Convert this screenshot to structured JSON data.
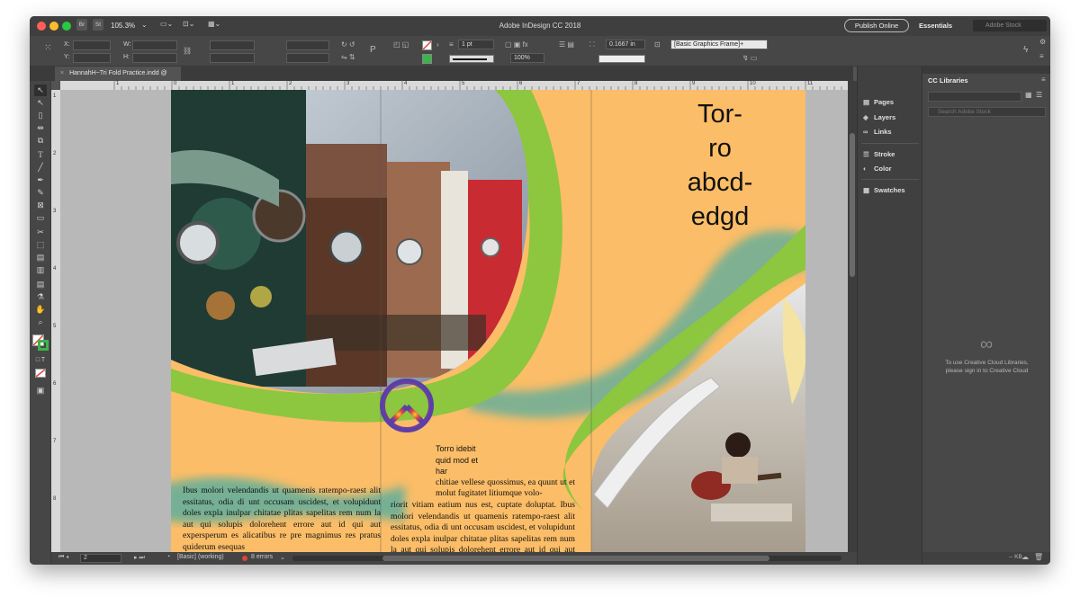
{
  "window": {
    "title": "Adobe InDesign CC 2018",
    "traffic_lights": [
      "#ff5f57",
      "#febc2e",
      "#28c840"
    ]
  },
  "titlebar": {
    "br_label": "Br",
    "st_label": "St",
    "zoom": "105.3%",
    "publish_label": "Publish Online",
    "workspace": "Essentials",
    "stock_placeholder": "Adobe Stock"
  },
  "control": {
    "x_label": "X:",
    "y_label": "Y:",
    "w_label": "W:",
    "h_label": "H:",
    "stroke_weight": "1 pt",
    "stroke_offset": "0.1667 in",
    "opacity": "100%",
    "object_style": "[Basic Graphics Frame]+"
  },
  "tab": {
    "close_glyph": "×",
    "label": "HannahH~Tri Fold Practice.indd @ 105%"
  },
  "ruler": {
    "h_ticks": [
      "1",
      "0",
      "1",
      "2",
      "3",
      "4",
      "5",
      "6",
      "7",
      "8",
      "9",
      "10",
      "11"
    ],
    "v_ticks": [
      "1",
      "2",
      "3",
      "4",
      "5",
      "6",
      "7",
      "8"
    ]
  },
  "document": {
    "page_color": "#fbbd67",
    "green_color": "#8dc63f",
    "teal_color": "#5fae9c",
    "headline": [
      "Tor-",
      "ro",
      "abcd-",
      "edgd"
    ],
    "col1_text": "Ibus molori velendandis ut quamenis ratempo-raest alit essitatus, odia di unt occusam uscidest, et volupidunt doles expla inulpar chitatae plitas sapelitas rem num la aut qui solupis dolorehent errore aut id qui aut expersperum es alicatibus re pre magnimus res pratus quiderum esequas",
    "col2_head": "Torro idebit quid mod et har",
    "col2_indent": "chitiae vellese quossimus, ea quunt ut et molut fugitatet litiumque volo-",
    "col2_text": "riorit vitiam eatium nus est, cuptate doluptat. Ibus molori velendandis ut quamenis ratempo-raest alit essitatus, odia di unt occusam uscidest, et volupidunt doles expla inulpar chitatae plitas sapelitas rem num la aut qui solupis dolorehent errore aut id qui aut expersperum es alicatibus re pre magnimus res pratus quiderum esequas comnimus ipiet debis mod et la dolupit et, elis sint vellupt aepelit quunt perit int, si ne consed essim comnihic to moluptae porporios rehenda"
  },
  "status": {
    "page_number": "2",
    "preflight_profile": "[Basic] (working)",
    "errors": "8 errors",
    "error_color": "#e0453a"
  },
  "panels": {
    "items": [
      {
        "icon": "pages-icon",
        "label": "Pages"
      },
      {
        "icon": "layers-icon",
        "label": "Layers"
      },
      {
        "icon": "links-icon",
        "label": "Links"
      },
      {
        "icon": "stroke-icon",
        "label": "Stroke"
      },
      {
        "icon": "color-icon",
        "label": "Color"
      },
      {
        "icon": "swatches-icon",
        "label": "Swatches"
      }
    ]
  },
  "cc_libraries": {
    "title": "CC Libraries",
    "search_placeholder": "Search Adobe Stock",
    "message_line1": "To use Creative Cloud Libraries,",
    "message_line2": "please sign in to Creative Cloud",
    "footer_size": "-- KB"
  }
}
